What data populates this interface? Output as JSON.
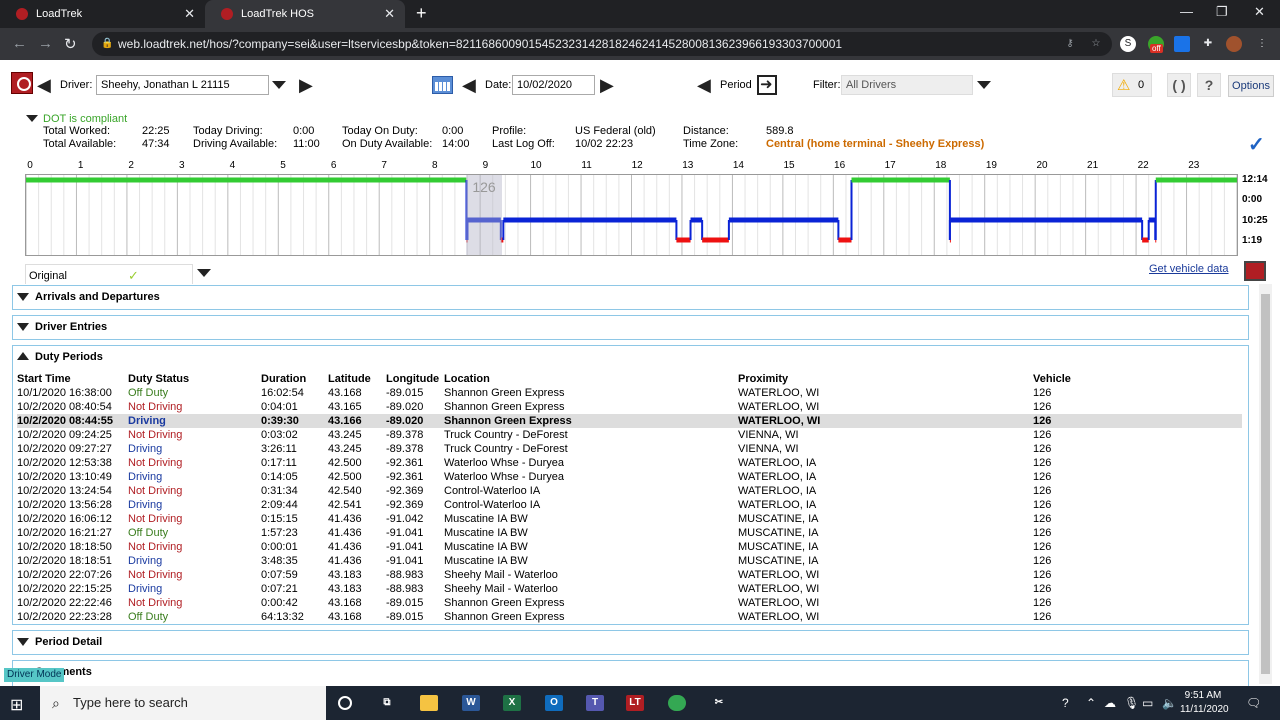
{
  "browser": {
    "tabs": [
      {
        "label": "LoadTrek",
        "active": false
      },
      {
        "label": "LoadTrek HOS",
        "active": true
      }
    ],
    "url": "web.loadtrek.net/hos/?company=sei&user=ltservicesbp&token=8211686009015452323142818246241452800813623966193303700001",
    "ext_badge": "off"
  },
  "toolbar": {
    "driver_label": "Driver:",
    "driver_value": "Sheehy, Jonathan L 21115",
    "date_label": "Date:",
    "date_value": "10/02/2020",
    "period_label": "Period",
    "filter_label": "Filter:",
    "filter_value": "All Drivers",
    "warning_count": "0",
    "refresh_symbol": "( )",
    "help_symbol": "?",
    "options_label": "Options"
  },
  "summary": {
    "status": "DOT is compliant",
    "total_worked_label": "Total Worked:",
    "total_worked": "22:25",
    "total_available_label": "Total Available:",
    "total_available": "47:34",
    "today_driving_label": "Today Driving:",
    "today_driving": "0:00",
    "driving_available_label": "Driving Available:",
    "driving_available": "11:00",
    "today_on_duty_label": "Today On Duty:",
    "today_on_duty": "0:00",
    "on_duty_available_label": "On Duty Available:",
    "on_duty_available": "14:00",
    "profile_label": "Profile:",
    "profile": "US Federal (old)",
    "last_log_off_label": "Last Log Off:",
    "last_log_off": "10/02 22:23",
    "distance_label": "Distance:",
    "distance": "589.8",
    "time_zone_label": "Time Zone:",
    "time_zone": "Central (home terminal - Sheehy Express)"
  },
  "graph": {
    "hours": [
      "0",
      "1",
      "2",
      "3",
      "4",
      "5",
      "6",
      "7",
      "8",
      "9",
      "10",
      "11",
      "12",
      "13",
      "14",
      "15",
      "16",
      "17",
      "18",
      "19",
      "20",
      "21",
      "22",
      "23"
    ],
    "row_totals": [
      "12:14",
      "0:00",
      "10:25",
      "1:19"
    ],
    "highlight_label": "126",
    "colors": {
      "off": "#33cc33",
      "sleeper": "#000000",
      "driving": "#0a23d6",
      "ondution": "#ee1111"
    },
    "segments": [
      {
        "status": "off",
        "start": 0.0,
        "end": 8.73
      },
      {
        "status": "on",
        "start": 8.73,
        "end": 8.75
      },
      {
        "status": "driving",
        "start": 8.75,
        "end": 9.41
      },
      {
        "status": "on",
        "start": 9.41,
        "end": 9.46
      },
      {
        "status": "driving",
        "start": 9.46,
        "end": 12.89
      },
      {
        "status": "on",
        "start": 12.89,
        "end": 13.17
      },
      {
        "status": "driving",
        "start": 13.17,
        "end": 13.4
      },
      {
        "status": "on",
        "start": 13.4,
        "end": 13.93
      },
      {
        "status": "driving",
        "start": 13.93,
        "end": 16.1
      },
      {
        "status": "on",
        "start": 16.1,
        "end": 16.36
      },
      {
        "status": "off",
        "start": 16.36,
        "end": 18.31
      },
      {
        "status": "on",
        "start": 18.31,
        "end": 18.31
      },
      {
        "status": "driving",
        "start": 18.31,
        "end": 22.12
      },
      {
        "status": "on",
        "start": 22.12,
        "end": 22.25
      },
      {
        "status": "driving",
        "start": 22.25,
        "end": 22.38
      },
      {
        "status": "on",
        "start": 22.38,
        "end": 22.39
      },
      {
        "status": "off",
        "start": 22.39,
        "end": 24.0
      }
    ]
  },
  "original_label": "Original",
  "vehicle_link": "Get vehicle data",
  "sections": {
    "arrivals": "Arrivals and Departures",
    "driver_entries": "Driver Entries",
    "duty_periods": "Duty Periods",
    "period_detail": "Period Detail",
    "comments": "Comments"
  },
  "duty_table": {
    "headers": [
      "Start Time",
      "Duty Status",
      "Duration",
      "Latitude",
      "Longitude",
      "Location",
      "Proximity",
      "Vehicle"
    ],
    "rows": [
      [
        "10/1/2020 16:38:00",
        "Off Duty",
        "16:02:54",
        "43.168",
        "-89.015",
        "Shannon Green Express",
        "WATERLOO, WI",
        "126"
      ],
      [
        "10/2/2020 08:40:54",
        "Not Driving",
        "0:04:01",
        "43.165",
        "-89.020",
        "Shannon Green Express",
        "WATERLOO, WI",
        "126"
      ],
      [
        "10/2/2020 08:44:55",
        "Driving",
        "0:39:30",
        "43.166",
        "-89.020",
        "Shannon Green Express",
        "WATERLOO, WI",
        "126"
      ],
      [
        "10/2/2020 09:24:25",
        "Not Driving",
        "0:03:02",
        "43.245",
        "-89.378",
        "Truck Country - DeForest",
        "VIENNA, WI",
        "126"
      ],
      [
        "10/2/2020 09:27:27",
        "Driving",
        "3:26:11",
        "43.245",
        "-89.378",
        "Truck Country - DeForest",
        "VIENNA, WI",
        "126"
      ],
      [
        "10/2/2020 12:53:38",
        "Not Driving",
        "0:17:11",
        "42.500",
        "-92.361",
        "Waterloo Whse - Duryea",
        "WATERLOO, IA",
        "126"
      ],
      [
        "10/2/2020 13:10:49",
        "Driving",
        "0:14:05",
        "42.500",
        "-92.361",
        "Waterloo Whse - Duryea",
        "WATERLOO, IA",
        "126"
      ],
      [
        "10/2/2020 13:24:54",
        "Not Driving",
        "0:31:34",
        "42.540",
        "-92.369",
        "Control-Waterloo IA",
        "WATERLOO, IA",
        "126"
      ],
      [
        "10/2/2020 13:56:28",
        "Driving",
        "2:09:44",
        "42.541",
        "-92.369",
        "Control-Waterloo IA",
        "WATERLOO, IA",
        "126"
      ],
      [
        "10/2/2020 16:06:12",
        "Not Driving",
        "0:15:15",
        "41.436",
        "-91.042",
        "Muscatine IA BW",
        "MUSCATINE, IA",
        "126"
      ],
      [
        "10/2/2020 16:21:27",
        "Off Duty",
        "1:57:23",
        "41.436",
        "-91.041",
        "Muscatine IA BW",
        "MUSCATINE, IA",
        "126"
      ],
      [
        "10/2/2020 18:18:50",
        "Not Driving",
        "0:00:01",
        "41.436",
        "-91.041",
        "Muscatine IA BW",
        "MUSCATINE, IA",
        "126"
      ],
      [
        "10/2/2020 18:18:51",
        "Driving",
        "3:48:35",
        "41.436",
        "-91.041",
        "Muscatine IA BW",
        "MUSCATINE, IA",
        "126"
      ],
      [
        "10/2/2020 22:07:26",
        "Not Driving",
        "0:07:59",
        "43.183",
        "-88.983",
        "Sheehy Mail - Waterloo",
        "WATERLOO, WI",
        "126"
      ],
      [
        "10/2/2020 22:15:25",
        "Driving",
        "0:07:21",
        "43.183",
        "-88.983",
        "Sheehy Mail - Waterloo",
        "WATERLOO, WI",
        "126"
      ],
      [
        "10/2/2020 22:22:46",
        "Not Driving",
        "0:00:42",
        "43.168",
        "-89.015",
        "Shannon Green Express",
        "WATERLOO, WI",
        "126"
      ],
      [
        "10/2/2020 22:23:28",
        "Off Duty",
        "64:13:32",
        "43.168",
        "-89.015",
        "Shannon Green Express",
        "WATERLOO, WI",
        "126"
      ]
    ],
    "selected_row": 2
  },
  "driver_mode": "Driver Mode",
  "taskbar": {
    "search_placeholder": "Type here to search",
    "time": "9:51 AM",
    "date": "11/11/2020"
  }
}
